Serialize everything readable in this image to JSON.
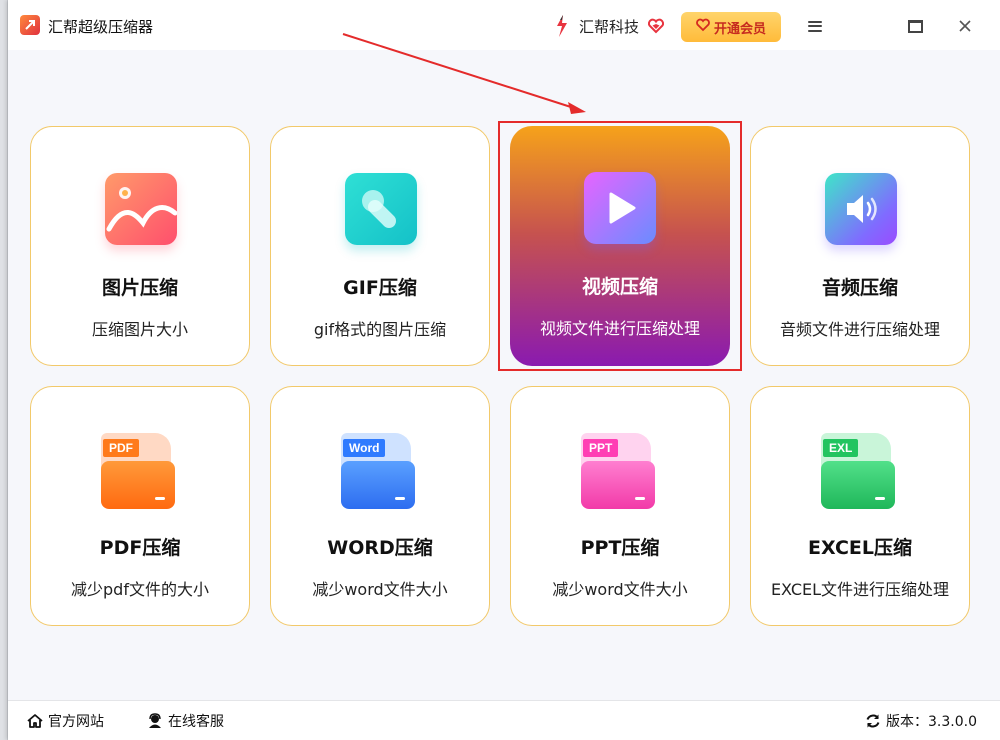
{
  "titlebar": {
    "app_title": "汇帮超级压缩器",
    "brand_name": "汇帮科技",
    "vip_label": "开通会员"
  },
  "cards": [
    {
      "title": "图片压缩",
      "desc": "压缩图片大小",
      "icon": "image-icon"
    },
    {
      "title": "GIF压缩",
      "desc": "gif格式的图片压缩",
      "icon": "gif-icon"
    },
    {
      "title": "视频压缩",
      "desc": "视频文件进行压缩处理",
      "icon": "video-play-icon",
      "active": true
    },
    {
      "title": "音频压缩",
      "desc": "音频文件进行压缩处理",
      "icon": "audio-speaker-icon"
    },
    {
      "title": "PDF压缩",
      "desc": "减少pdf文件的大小",
      "icon": "pdf-folder-icon",
      "tag": "PDF"
    },
    {
      "title": "WORD压缩",
      "desc": "减少word文件大小",
      "icon": "word-folder-icon",
      "tag": "Word"
    },
    {
      "title": "PPT压缩",
      "desc": "减少word文件大小",
      "icon": "ppt-folder-icon",
      "tag": "PPT"
    },
    {
      "title": "EXCEL压缩",
      "desc": "EXCEL文件进行压缩处理",
      "icon": "excel-folder-icon",
      "tag": "EXL"
    }
  ],
  "bottombar": {
    "official_site": "官方网站",
    "online_service": "在线客服",
    "version": "版本：3.3.0.0"
  },
  "colors": {
    "accent_border": "#f2c96a",
    "highlight_red": "#e42b2b",
    "vip_gold": "#ffc247"
  }
}
